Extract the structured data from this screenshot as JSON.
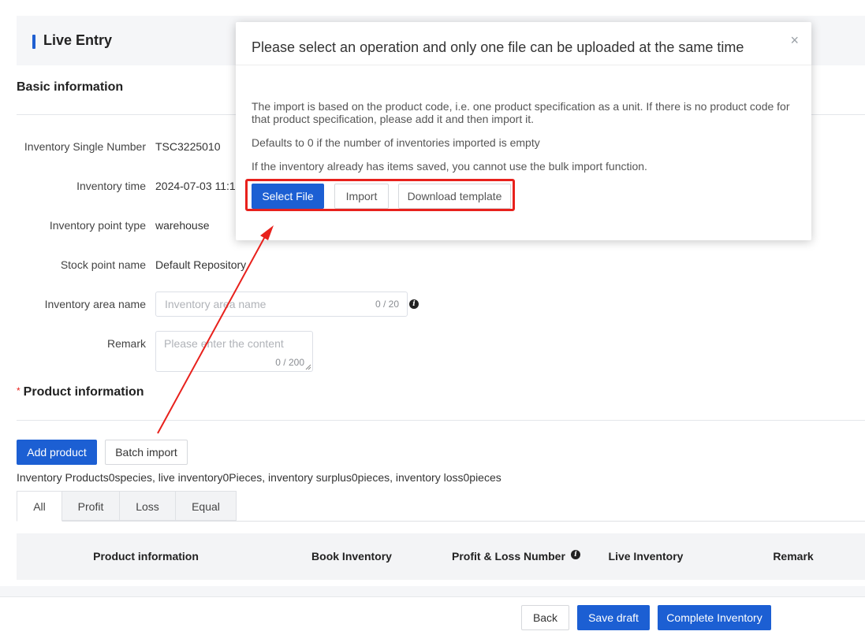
{
  "header": {
    "title": "Live Entry"
  },
  "basic": {
    "title": "Basic information",
    "fields": [
      {
        "label": "Inventory Single Number",
        "value": "TSC3225010"
      },
      {
        "label": "Inventory time",
        "value": "2024-07-03 11:1"
      },
      {
        "label": "Inventory point type",
        "value": "warehouse"
      },
      {
        "label": "Stock point name",
        "value": "Default Repository"
      }
    ],
    "area": {
      "label": "Inventory area name",
      "placeholder": "Inventory area name",
      "counter": "0 / 20"
    },
    "remark": {
      "label": "Remark",
      "placeholder": "Please enter the content",
      "counter": "0 / 200"
    }
  },
  "product": {
    "required_mark": "*",
    "title": "Product information",
    "add_label": "Add product",
    "batch_label": "Batch import",
    "summary": "Inventory Products0species, live inventory0Pieces, inventory surplus0pieces, inventory loss0pieces",
    "tabs": [
      "All",
      "Profit",
      "Loss",
      "Equal"
    ],
    "columns": [
      "Product information",
      "Book Inventory",
      "Profit & Loss Number",
      "Live Inventory",
      "Remark"
    ]
  },
  "footer": {
    "back": "Back",
    "save_draft": "Save draft",
    "complete": "Complete Inventory"
  },
  "modal": {
    "title": "Please select an operation and only one file can be uploaded at the same time",
    "close": "×",
    "lines": [
      "The import is based on the product code, i.e. one product specification as a unit. If there is no product code for that product specification, please add it and then import it.",
      "Defaults to 0 if the number of inventories imported is empty",
      "If the inventory already has items saved, you cannot use the bulk import function."
    ],
    "select_file": "Select File",
    "import": "Import",
    "download_template": "Download template"
  },
  "colors": {
    "primary": "#1c5fd3",
    "annotation": "#e8211c"
  }
}
